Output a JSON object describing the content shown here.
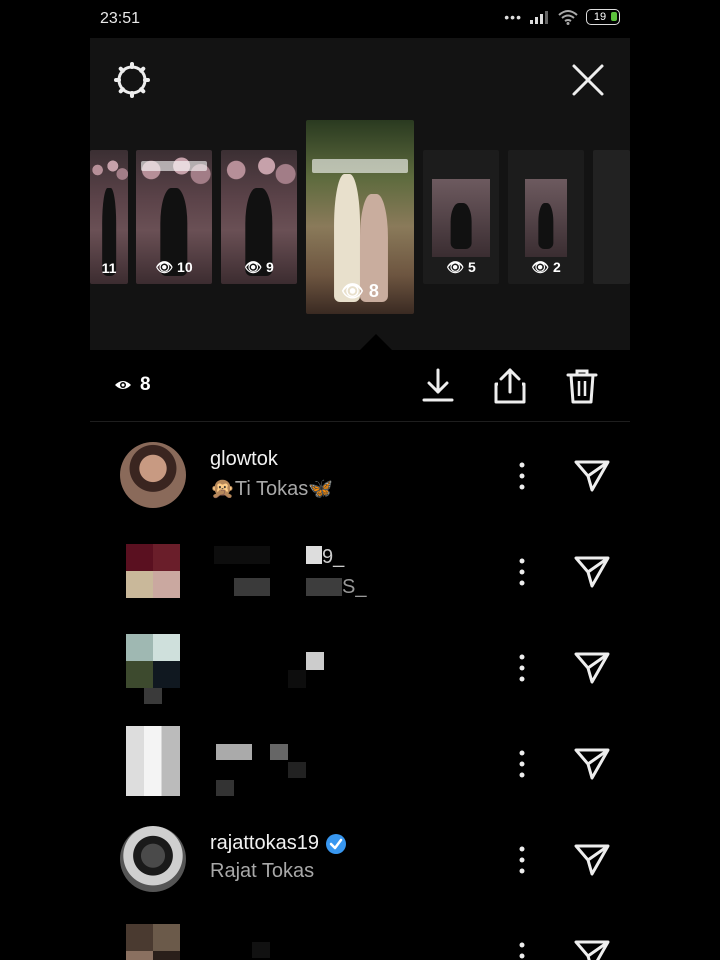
{
  "status": {
    "time": "23:51",
    "signal_dots": "•••",
    "battery": "19"
  },
  "header": {
    "settings_icon": "gear-icon",
    "close_icon": "close-icon"
  },
  "stories": [
    {
      "views": "11"
    },
    {
      "views": "10"
    },
    {
      "views": "9"
    },
    {
      "views": "8",
      "active": true
    },
    {
      "views": "5"
    },
    {
      "views": "2"
    }
  ],
  "actions": {
    "view_count": "8",
    "download_icon": "download-icon",
    "share_icon": "share-icon",
    "delete_icon": "trash-icon"
  },
  "viewers": [
    {
      "username": "glowtok",
      "full_name": "Ti Tokas"
    },
    {
      "username": "9_",
      "full_name": "S_"
    },
    {
      "username": "",
      "full_name": ""
    },
    {
      "username": "",
      "full_name": ""
    },
    {
      "username": "rajattokas19",
      "full_name": "Rajat Tokas",
      "verified": true
    },
    {
      "username": "",
      "full_name": ""
    }
  ],
  "colors": {
    "background": "#000000",
    "panel": "#131313",
    "verified": "#3897f0",
    "battery": "#5cc13c"
  }
}
